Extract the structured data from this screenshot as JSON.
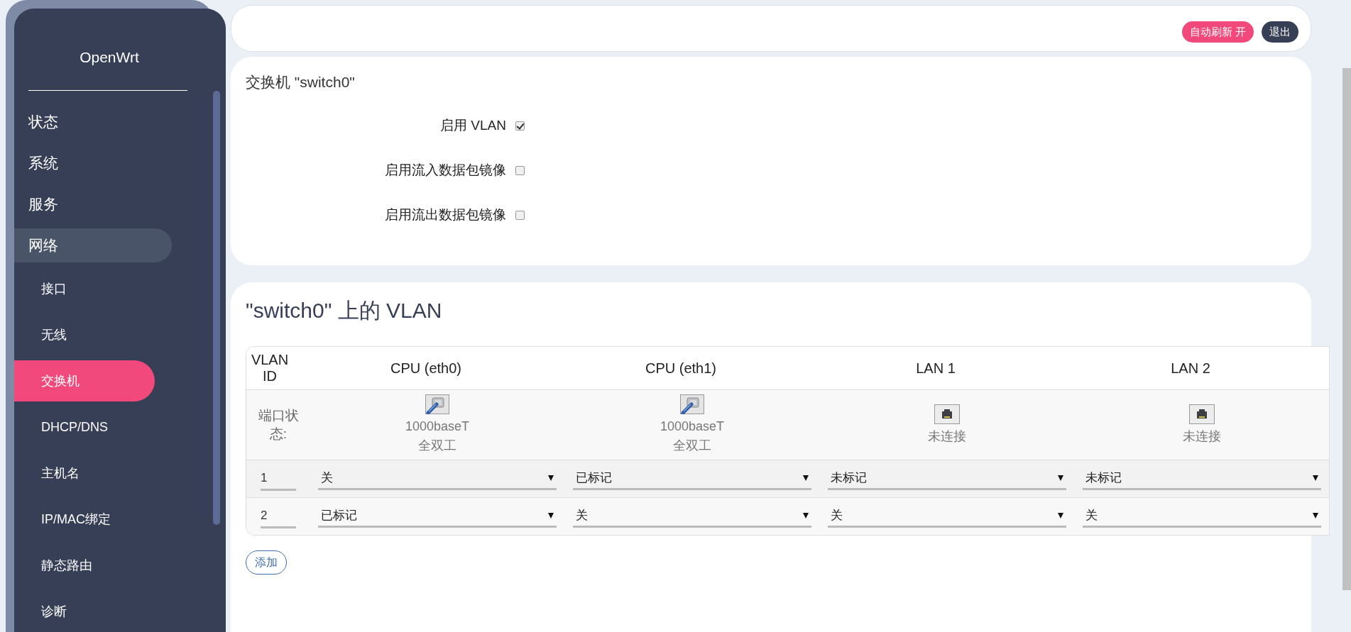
{
  "sidebar": {
    "brand": "OpenWrt",
    "items": [
      {
        "label": "状态",
        "expanded": false
      },
      {
        "label": "系统",
        "expanded": false
      },
      {
        "label": "服务",
        "expanded": false
      },
      {
        "label": "网络",
        "expanded": true,
        "children": [
          {
            "label": "接口",
            "selected": false
          },
          {
            "label": "无线",
            "selected": false
          },
          {
            "label": "交换机",
            "selected": true
          },
          {
            "label": "DHCP/DNS",
            "selected": false
          },
          {
            "label": "主机名",
            "selected": false
          },
          {
            "label": "IP/MAC绑定",
            "selected": false
          },
          {
            "label": "静态路由",
            "selected": false
          },
          {
            "label": "诊断",
            "selected": false
          }
        ]
      }
    ]
  },
  "header": {
    "buttons": [
      {
        "label": "自动刷新 开",
        "kind": "refresh"
      },
      {
        "label": "退出",
        "kind": "logout"
      }
    ]
  },
  "switch_section": {
    "title": "交换机 \"switch0\"",
    "options": [
      {
        "label": "启用 VLAN",
        "checked": true
      },
      {
        "label": "启用流入数据包镜像",
        "checked": false
      },
      {
        "label": "启用流出数据包镜像",
        "checked": false
      }
    ]
  },
  "vlan_section": {
    "title": "\"switch0\" 上的 VLAN",
    "table": {
      "columns": [
        "VLAN ID",
        "CPU (eth0)",
        "CPU (eth1)",
        "LAN 1",
        "LAN 2"
      ],
      "port_status": {
        "label": "端口状态:",
        "ports": [
          {
            "connected": true,
            "lines": [
              "1000baseT",
              "全双工"
            ]
          },
          {
            "connected": true,
            "lines": [
              "1000baseT",
              "全双工"
            ]
          },
          {
            "connected": false,
            "lines": [
              "未连接"
            ]
          },
          {
            "connected": false,
            "lines": [
              "未连接"
            ]
          }
        ]
      },
      "rows": [
        {
          "vlan_id": "1",
          "ports": [
            "关",
            "已标记",
            "未标记",
            "未标记"
          ]
        },
        {
          "vlan_id": "2",
          "ports": [
            "已标记",
            "关",
            "关",
            "关"
          ]
        }
      ]
    },
    "add_button": "添加"
  }
}
